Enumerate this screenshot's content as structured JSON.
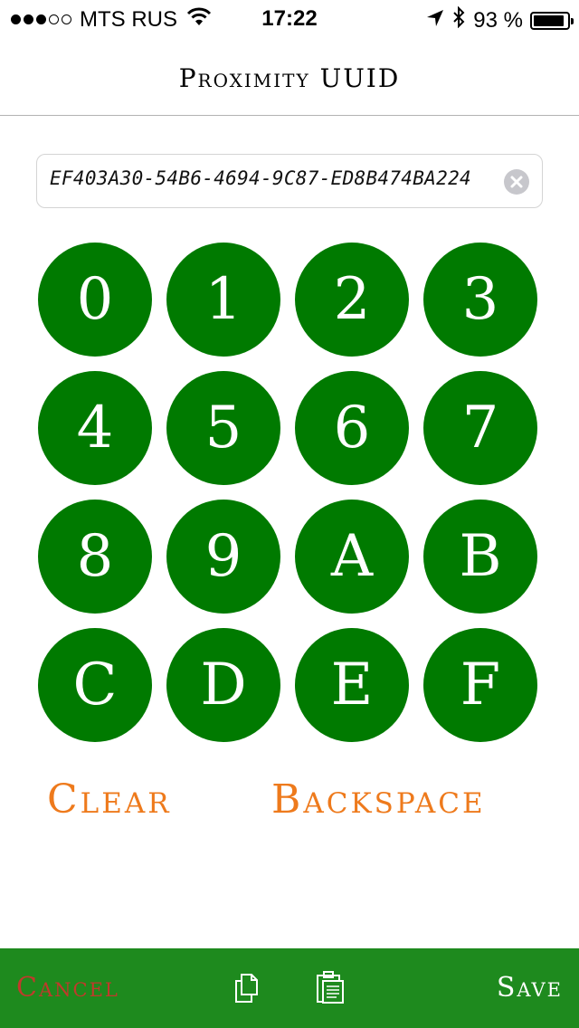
{
  "status_bar": {
    "carrier": "MTS RUS",
    "time": "17:22",
    "battery_percent": "93 %",
    "battery_level": 0.93,
    "signal_bars_filled": 3,
    "signal_bars_total": 5,
    "icons": [
      "wifi-icon",
      "location-arrow-icon",
      "bluetooth-icon",
      "battery-icon"
    ]
  },
  "nav": {
    "title": "Proximity UUID"
  },
  "uuid_field": {
    "value": "EF403A30-54B6-4694-9C87-ED8B474BA224",
    "clear_icon": "clear-circle-icon"
  },
  "keypad": {
    "keys": [
      "0",
      "1",
      "2",
      "3",
      "4",
      "5",
      "6",
      "7",
      "8",
      "9",
      "A",
      "B",
      "C",
      "D",
      "E",
      "F"
    ]
  },
  "actions": {
    "clear_label": "Clear",
    "backspace_label": "Backspace"
  },
  "toolbar": {
    "cancel_label": "Cancel",
    "save_label": "Save",
    "copy_icon": "copy-icon",
    "paste_icon": "paste-icon"
  },
  "colors": {
    "key_background": "#007a00",
    "key_text": "#ffffff",
    "action_text": "#ee7a1c",
    "toolbar_background": "#1e8a1e",
    "cancel_text": "#c0392b",
    "save_text": "#ffffff"
  }
}
